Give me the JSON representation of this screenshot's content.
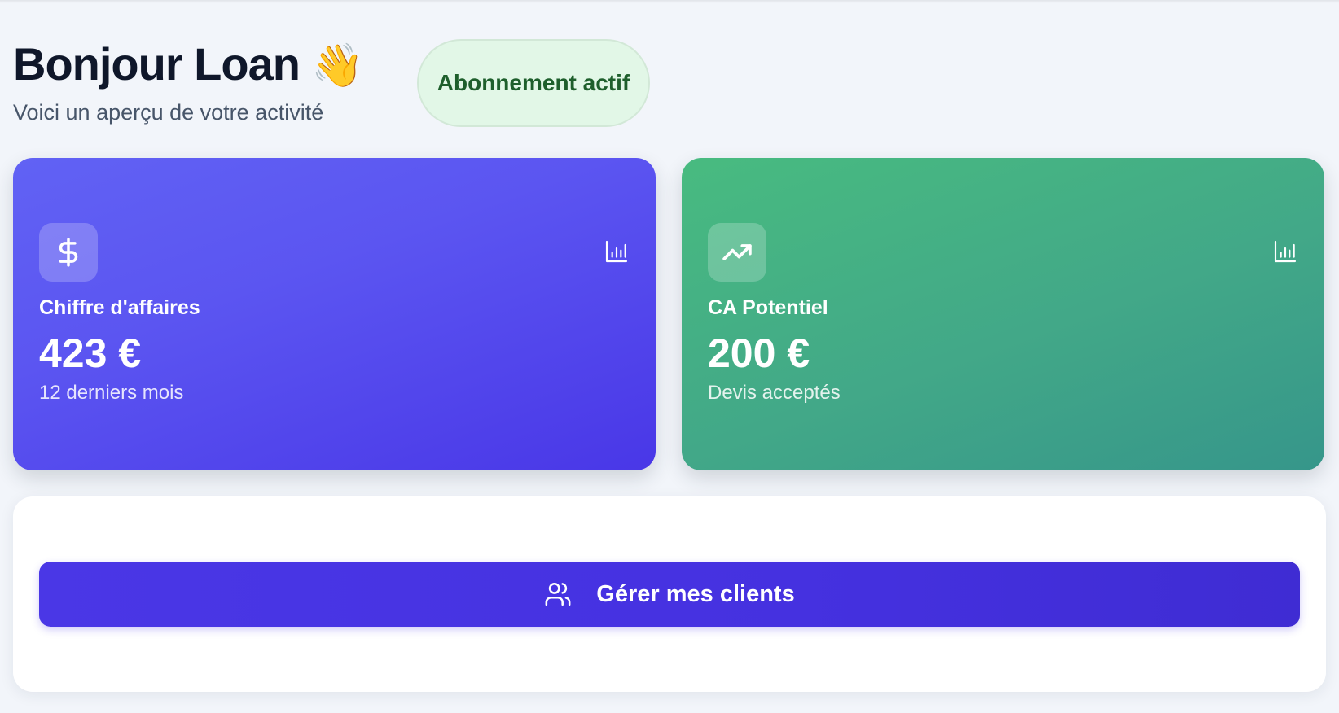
{
  "header": {
    "title": "Bonjour Loan",
    "wave_emoji": "👋",
    "subtitle": "Voici un aperçu de votre activité",
    "status_badge": "Abonnement actif"
  },
  "stats": [
    {
      "icon": "dollar-icon",
      "action_icon": "bar-chart-icon",
      "label": "Chiffre d'affaires",
      "value": "423 €",
      "subtext": "12 derniers mois",
      "color_start": "#6162f4",
      "color_end": "#4937e7"
    },
    {
      "icon": "trending-up-icon",
      "action_icon": "bar-chart-icon",
      "label": "CA Potentiel",
      "value": "200 €",
      "subtext": "Devis acceptés",
      "color_start": "#48bb80",
      "color_end": "#36968a"
    }
  ],
  "actions": {
    "manage_clients_label": "Gérer mes clients",
    "manage_clients_icon": "users-icon"
  },
  "colors": {
    "background": "#f2f5fa",
    "primary": "#4a37e6",
    "badge_bg": "#e2f7e7",
    "badge_text": "#1e5f2c",
    "heading": "#0f172a"
  }
}
